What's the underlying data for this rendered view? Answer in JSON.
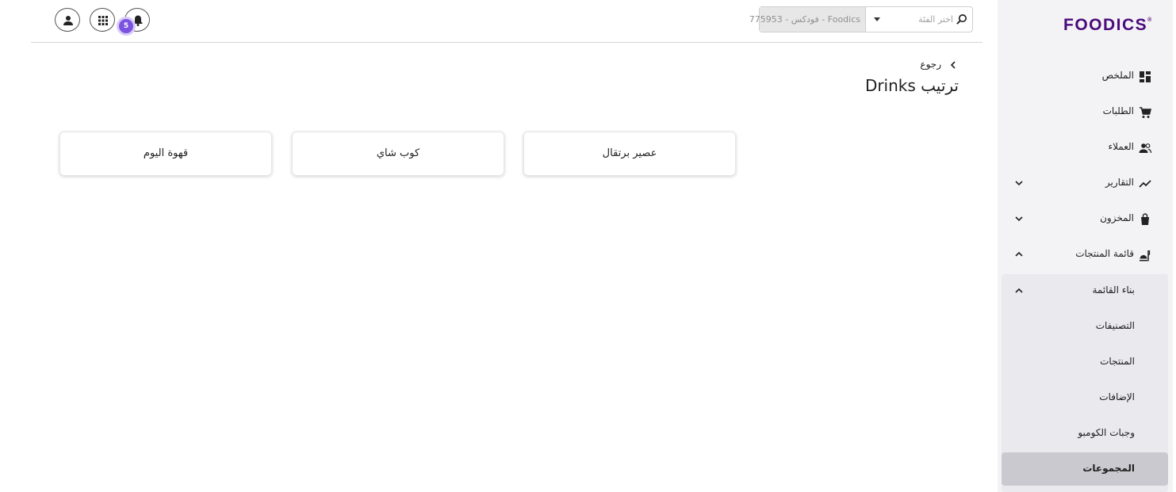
{
  "brand": {
    "logo_text": "FOODICS",
    "logo_mark": "®",
    "color": "#4a0a7a"
  },
  "sidebar": {
    "items": [
      {
        "label": "الملخص",
        "icon": "dashboard-icon"
      },
      {
        "label": "الطلبات",
        "icon": "cart-icon"
      },
      {
        "label": "العملاء",
        "icon": "people-icon"
      },
      {
        "label": "التقارير",
        "icon": "trend-icon",
        "expandable": true
      },
      {
        "label": "المخزون",
        "icon": "bag-icon",
        "expandable": true
      },
      {
        "label": "قائمة المنتجات",
        "icon": "menu-food-icon",
        "expandable": true,
        "expanded": true
      }
    ],
    "submenu": {
      "title": "بناء القائمة",
      "items": [
        {
          "label": "التصنيفات"
        },
        {
          "label": "المنتجات"
        },
        {
          "label": "الإضافات"
        },
        {
          "label": "وجبات الكومبو"
        },
        {
          "label": "المجموعات",
          "active": true
        }
      ]
    }
  },
  "header": {
    "notifications_count": "5",
    "search": {
      "placeholder": "اختر الفئة",
      "selected_account": "775953 - فودكس - Foodics"
    }
  },
  "main": {
    "back_label": "رجوع",
    "title": "ترتيب Drinks",
    "cards": [
      {
        "label": "قهوة اليوم"
      },
      {
        "label": "كوب شاي"
      },
      {
        "label": "عصير برتقال"
      }
    ]
  },
  "colors": {
    "badge": "#7b53e0",
    "sidebar_bg": "#f3f3f6",
    "active_bg": "#c9c9cf"
  }
}
